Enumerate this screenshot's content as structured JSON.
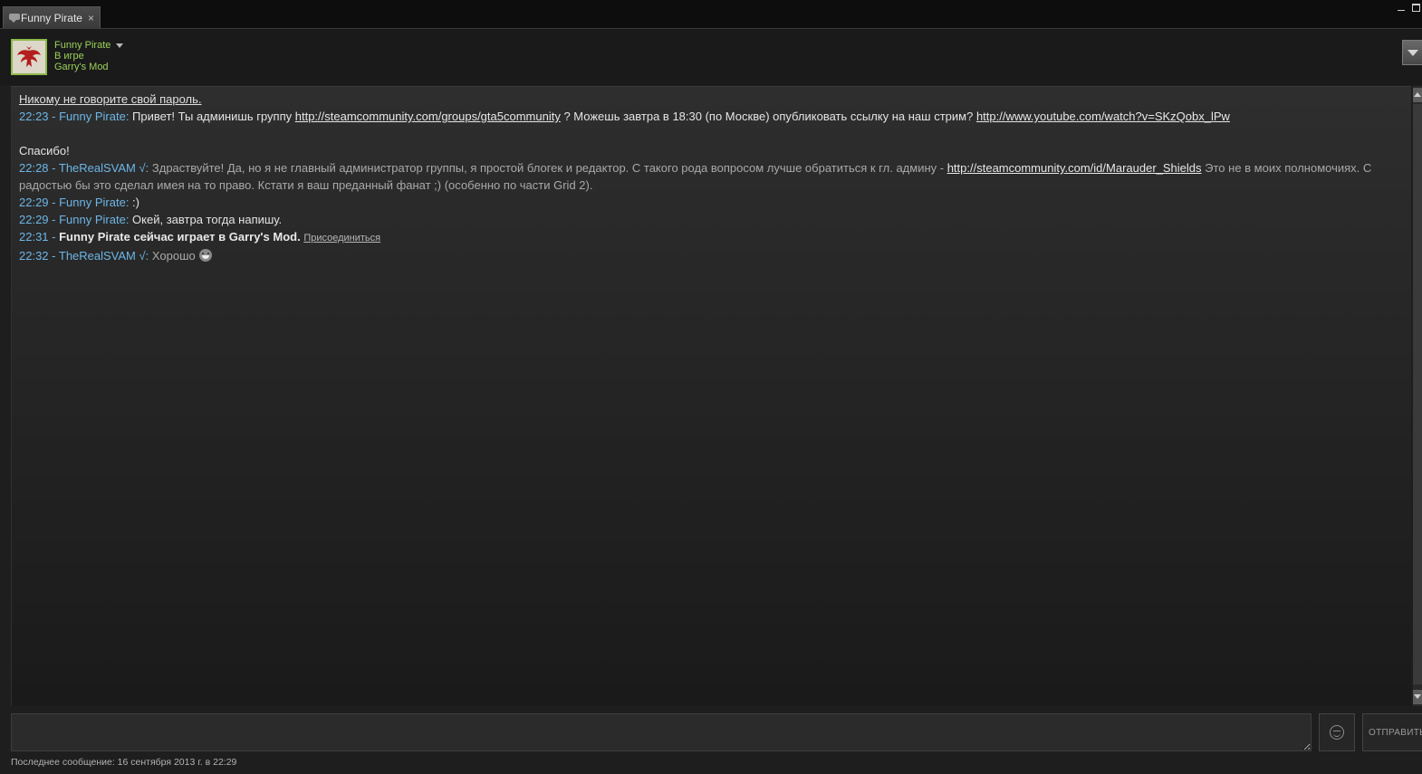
{
  "tab": {
    "title": "Funny Pirate",
    "close": "×"
  },
  "header": {
    "friend_name": "Funny Pirate",
    "status": "В игре",
    "game": "Garry's Mod",
    "accent_color": "#9bd05a"
  },
  "chat": {
    "warning": "Никому не говорите свой пароль.",
    "messages": [
      {
        "time": "22:23",
        "sender": "Funny Pirate",
        "parts": [
          "Привет! Ты админишь группу ",
          "http://steamcommunity.com/groups/gta5community",
          " ? Можешь завтра в 18:30 (по Москве) опубликовать ссылку на наш стрим? ",
          "http://www.youtube.com/watch?v=SKzQobx_lPw"
        ],
        "continuation": "Спасибо!"
      },
      {
        "time": "22:28",
        "sender": "TheRealSVAM √",
        "parts": [
          "Здраствуйте! Да, но я не главный администратор группы, я простой блогек и редактор. С такого рода вопросом лучше обратиться к гл. админу - ",
          "http://steamcommunity.com/id/Marauder_Shields",
          " Это не в моих полномочиях. С радостью бы это сделал имея на то право. Кстати я ваш преданный фанат ;) (особенно по части Grid 2)."
        ]
      },
      {
        "time": "22:29",
        "sender": "Funny Pirate",
        "text": ":)"
      },
      {
        "time": "22:29",
        "sender": "Funny Pirate",
        "text": "Окей, завтра тогда напишу."
      },
      {
        "time": "22:31",
        "event": "Funny Pirate сейчас играет в Garry's Mod.",
        "join": "Присоединиться"
      },
      {
        "time": "22:32",
        "sender": "TheRealSVAM √",
        "text": "Хорошо"
      }
    ]
  },
  "input": {
    "value": "",
    "send_label": "ОТПРАВИТЬ"
  },
  "status_bar": {
    "last_message": "Последнее сообщение: 16 сентября 2013 г. в 22:29"
  },
  "icons": {
    "tab": "chat-bubble-icon",
    "avatar": "red-bird-emblem",
    "emoticon": "smiley-icon"
  }
}
